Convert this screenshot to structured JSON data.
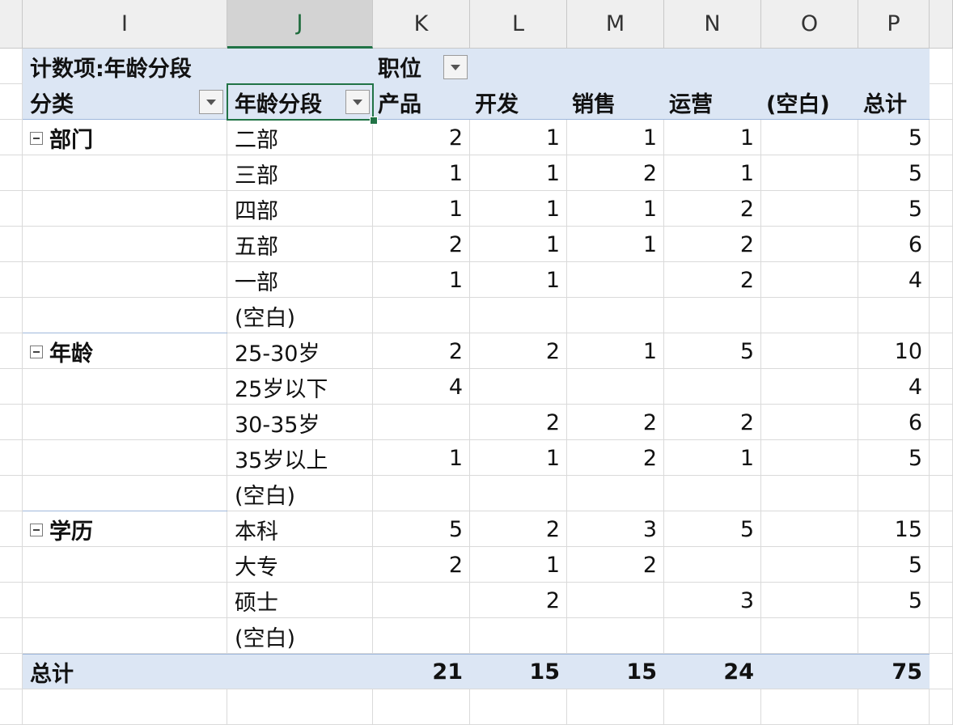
{
  "column_headers": [
    "I",
    "J",
    "K",
    "L",
    "M",
    "N",
    "O",
    "P"
  ],
  "pivot": {
    "count_label": "计数项:年龄分段",
    "col_field": "职位",
    "row_field_1": "分类",
    "row_field_2": "年龄分段",
    "columns": [
      "产品",
      "开发",
      "销售",
      "运营",
      "(空白)",
      "总计"
    ],
    "groups": [
      {
        "name": "部门",
        "rows": [
          {
            "label": "二部",
            "values": [
              "2",
              "1",
              "1",
              "1",
              "",
              "5"
            ]
          },
          {
            "label": "三部",
            "values": [
              "1",
              "1",
              "2",
              "1",
              "",
              "5"
            ]
          },
          {
            "label": "四部",
            "values": [
              "1",
              "1",
              "1",
              "2",
              "",
              "5"
            ]
          },
          {
            "label": "五部",
            "values": [
              "2",
              "1",
              "1",
              "2",
              "",
              "6"
            ]
          },
          {
            "label": "一部",
            "values": [
              "1",
              "1",
              "",
              "2",
              "",
              "4"
            ]
          },
          {
            "label": "(空白)",
            "values": [
              "",
              "",
              "",
              "",
              "",
              ""
            ]
          }
        ]
      },
      {
        "name": "年龄",
        "rows": [
          {
            "label": "25-30岁",
            "values": [
              "2",
              "2",
              "1",
              "5",
              "",
              "10"
            ]
          },
          {
            "label": "25岁以下",
            "values": [
              "4",
              "",
              "",
              "",
              "",
              "4"
            ]
          },
          {
            "label": "30-35岁",
            "values": [
              "",
              "2",
              "2",
              "2",
              "",
              "6"
            ]
          },
          {
            "label": "35岁以上",
            "values": [
              "1",
              "1",
              "2",
              "1",
              "",
              "5"
            ]
          },
          {
            "label": "(空白)",
            "values": [
              "",
              "",
              "",
              "",
              "",
              ""
            ]
          }
        ]
      },
      {
        "name": "学历",
        "rows": [
          {
            "label": "本科",
            "values": [
              "5",
              "2",
              "3",
              "5",
              "",
              "15"
            ]
          },
          {
            "label": "大专",
            "values": [
              "2",
              "1",
              "2",
              "",
              "",
              "5"
            ]
          },
          {
            "label": "硕士",
            "values": [
              "",
              "2",
              "",
              "3",
              "",
              "5"
            ]
          },
          {
            "label": "(空白)",
            "values": [
              "",
              "",
              "",
              "",
              "",
              ""
            ]
          }
        ]
      }
    ],
    "grand_total": {
      "label": "总计",
      "values": [
        "21",
        "15",
        "15",
        "24",
        "",
        "75"
      ]
    }
  },
  "colors": {
    "header_band": "#dce6f4",
    "selection": "#217346",
    "col_header_bg": "#efefef"
  },
  "icons": {
    "collapse": "minus-box-icon",
    "filter": "dropdown-arrow-icon"
  }
}
